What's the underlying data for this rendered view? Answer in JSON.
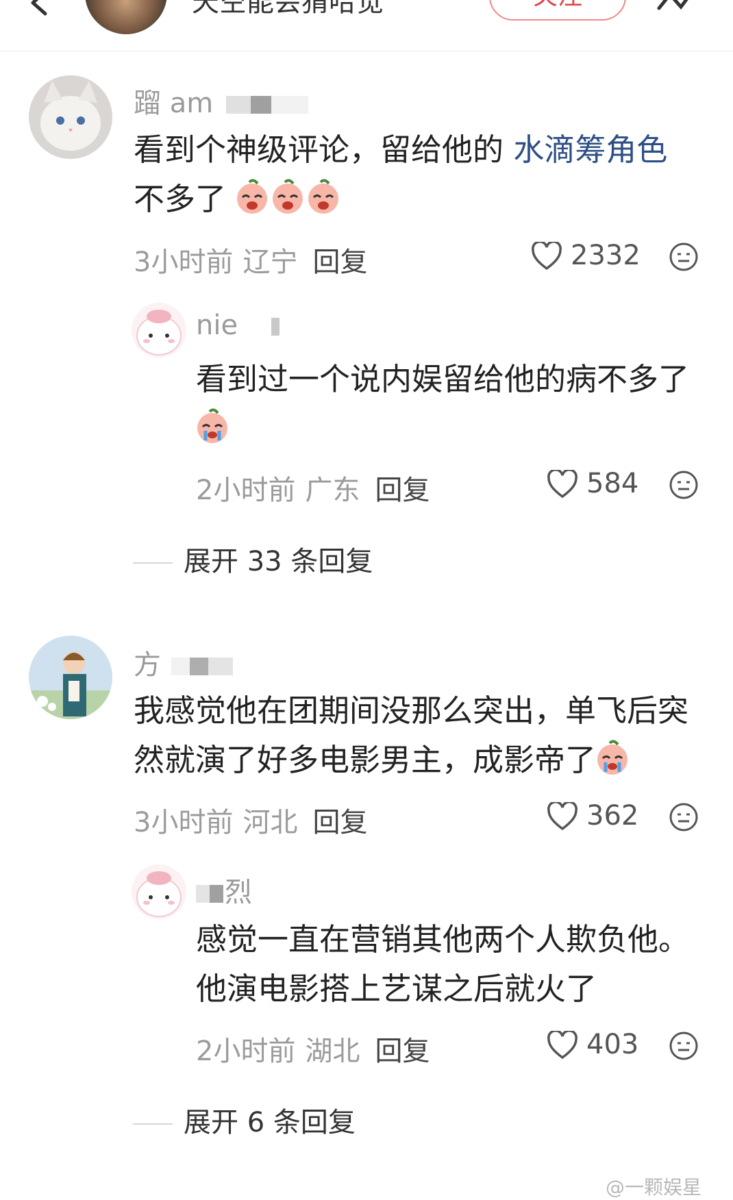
{
  "header": {
    "title": "天空能会猜哈觉",
    "follow_label": "关注"
  },
  "comments": [
    {
      "username": "蹓 am",
      "text_plain": "看到个神级评论，留给他的 ",
      "text_highlight": "水滴筹角色",
      "text_rest": "不多了",
      "time": "3小时前",
      "location": "辽宁",
      "reply_label": "回复",
      "likes": "2332",
      "reply": {
        "username": "nie",
        "text": "看到过一个说内娱留给他的病不多了",
        "time": "2小时前",
        "location": "广东",
        "reply_label": "回复",
        "likes": "584"
      },
      "expand_label": "展开 33 条回复"
    },
    {
      "username": "方",
      "text": "我感觉他在团期间没那么突出，单飞后突然就演了好多电影男主，成影帝了",
      "time": "3小时前",
      "location": "河北",
      "reply_label": "回复",
      "likes": "362",
      "reply": {
        "username": "烈",
        "text": "感觉一直在营销其他两个人欺负他。他演电影搭上艺谋之后就火了",
        "time": "2小时前",
        "location": "湖北",
        "reply_label": "回复",
        "likes": "403"
      },
      "expand_label": "展开 6 条回复"
    }
  ],
  "watermark": "@一颗娱星",
  "colors": {
    "highlight_link": "#2e4f86",
    "follow_border": "#f08a8a",
    "meta_gray": "#9b9b9b"
  },
  "icons": [
    "back-arrow-icon",
    "share-icon",
    "heart-icon",
    "emoji-reaction-icon",
    "crying-emoji-icon"
  ]
}
